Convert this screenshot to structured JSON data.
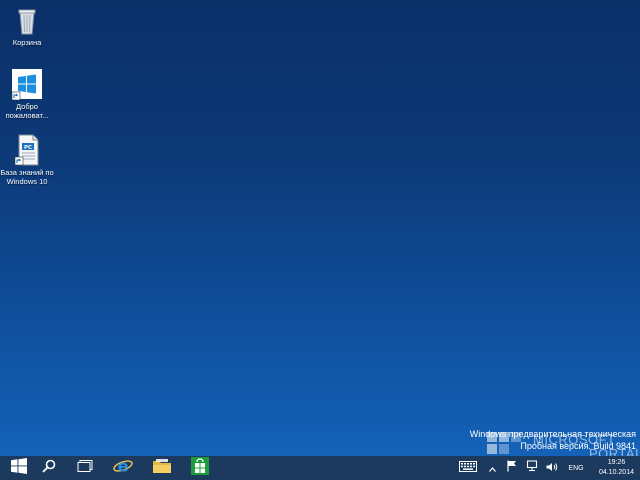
{
  "desktop": {
    "icons": [
      {
        "label": "Корзина",
        "icon": "recycle-bin-icon"
      },
      {
        "label": "Добро пожаловат...",
        "icon": "windows-welcome-icon"
      },
      {
        "label": "База знаний по Windows 10",
        "icon": "knowledge-base-document-icon"
      }
    ],
    "watermark_line1": "Windows предварительная техническая",
    "watermark_line2": "Пробная версия. Build 9841",
    "portal_logo_line1": "MICROSOFT",
    "portal_logo_line2": "PORTAL"
  },
  "taskbar": {
    "apps": [
      {
        "icon": "start-windows-icon"
      },
      {
        "icon": "search-icon"
      },
      {
        "icon": "task-view-icon"
      },
      {
        "icon": "internet-explorer-icon"
      },
      {
        "icon": "file-explorer-icon"
      },
      {
        "icon": "store-icon"
      }
    ],
    "tray": {
      "keyboard_icon": "touch-keyboard-icon",
      "chevron_icon": "show-hidden-icons-icon",
      "flag_icon": "action-center-flag-icon",
      "network_icon": "network-icon",
      "volume_icon": "volume-icon",
      "language": "ENG",
      "time": "19:26",
      "date": "04.10.2014"
    }
  },
  "colors": {
    "desktop_top": "#0b2f68",
    "desktop_bottom": "#1462b8",
    "taskbar": "#1b3a5e",
    "store_green": "#1e9b3c",
    "ie_blue": "#2a8ee0",
    "folder_yellow": "#e8b840"
  }
}
